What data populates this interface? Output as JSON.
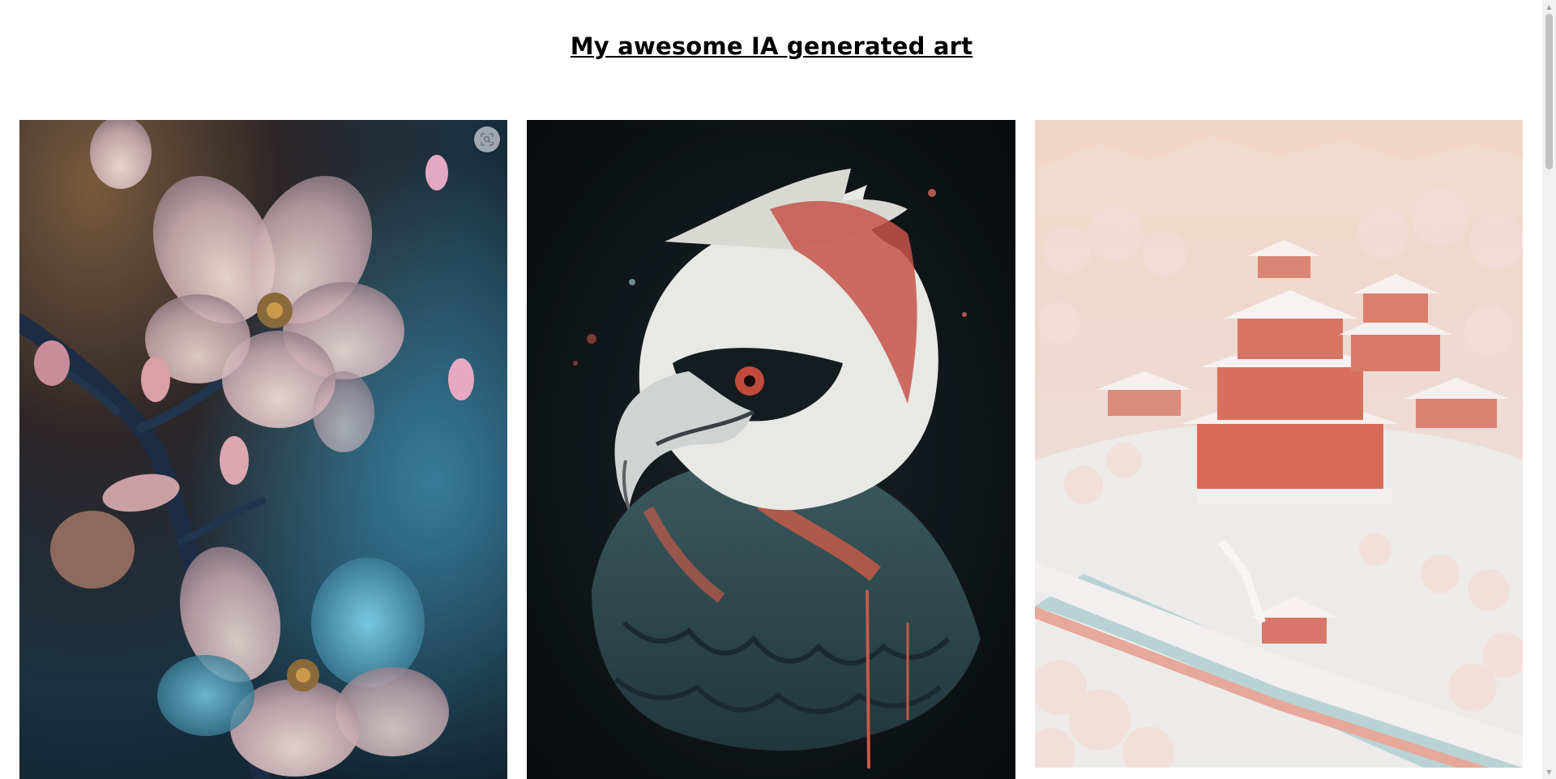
{
  "page": {
    "title": "My awesome IA generated art"
  },
  "gallery": {
    "images": [
      {
        "name": "cherry-blossom-art"
      },
      {
        "name": "eagle-portrait-art"
      },
      {
        "name": "snowy-palace-art"
      }
    ],
    "overlay_icon": "visual-search-icon"
  },
  "colors": {
    "background": "#ffffff",
    "title": "#000000",
    "scrollbar_track": "#f1f1f1",
    "scrollbar_thumb": "#c1c1c1"
  }
}
